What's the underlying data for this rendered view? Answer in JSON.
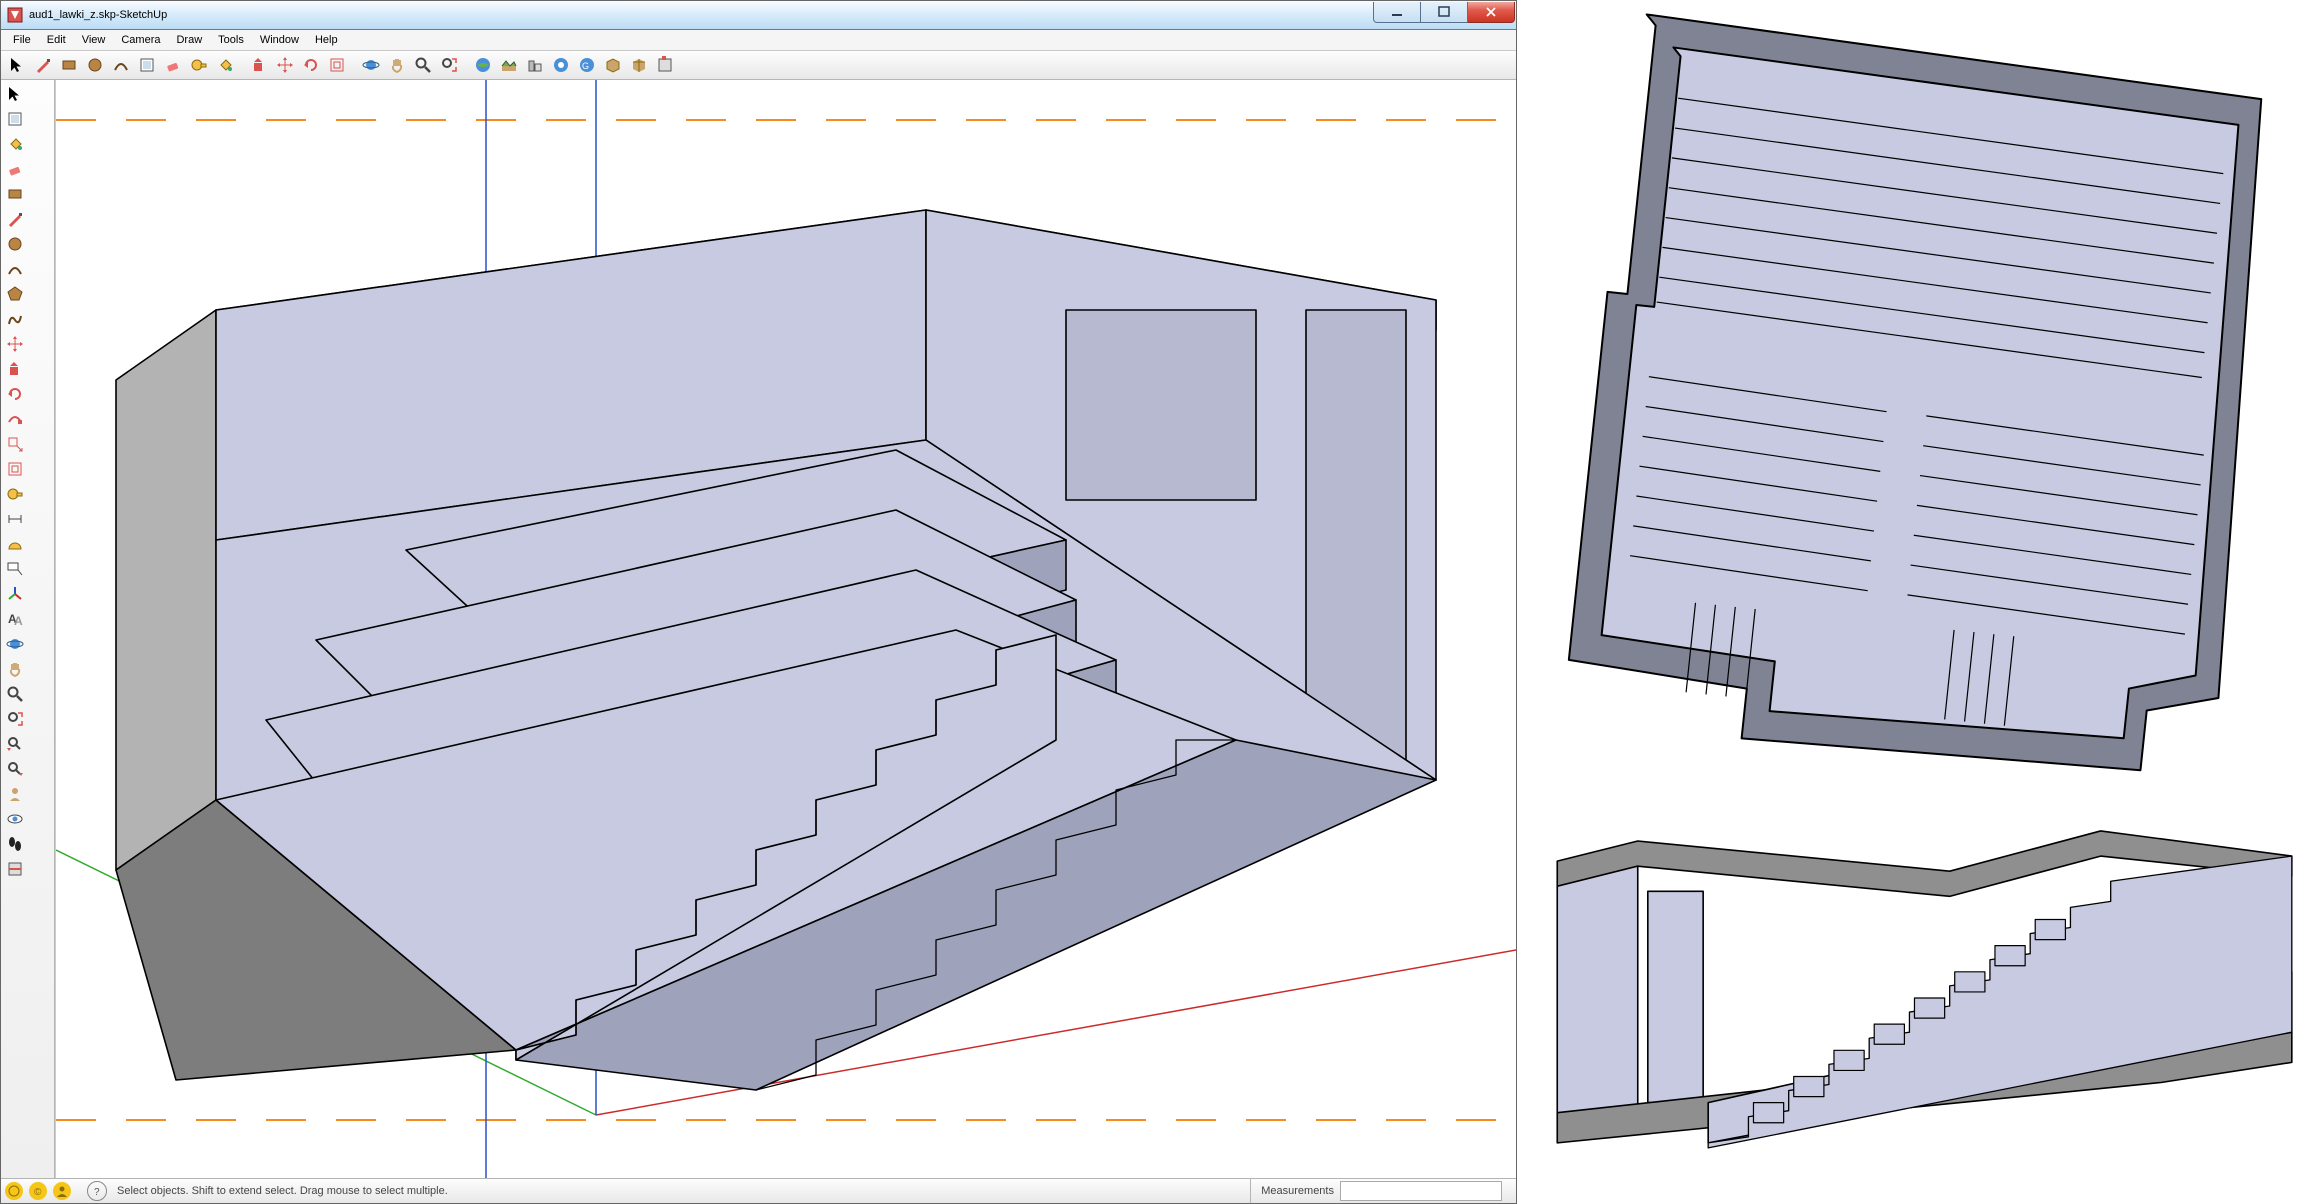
{
  "window": {
    "filename": "aud1_lawki_z.skp",
    "appname": "SketchUp",
    "sep": " - "
  },
  "menu": [
    "File",
    "Edit",
    "View",
    "Camera",
    "Draw",
    "Tools",
    "Window",
    "Help"
  ],
  "main_toolbar_icons": [
    "select-arrow-icon",
    "line-pencil-icon",
    "rectangle-icon",
    "circle-icon",
    "arc-icon",
    "make-component-icon",
    "eraser-icon",
    "tape-measure-icon",
    "paint-bucket-icon",
    "sep",
    "push-pull-icon",
    "move-icon",
    "rotate-icon",
    "offset-icon",
    "sep",
    "orbit-icon",
    "pan-icon",
    "zoom-icon",
    "zoom-extents-icon",
    "sep",
    "add-location-icon",
    "toggle-terrain-icon",
    "add-building-icon",
    "photo-textures-icon",
    "preview-ge-icon",
    "get-models-icon",
    "share-model-icon",
    "extensions-icon"
  ],
  "left_toolbox_icons": [
    "select-arrow-icon",
    "make-component-icon",
    "paint-bucket-icon",
    "eraser-icon",
    "rectangle-icon",
    "line-pencil-icon",
    "circle-icon",
    "arc-icon",
    "polygon-icon",
    "freehand-icon",
    "move-icon",
    "push-pull-icon",
    "rotate-icon",
    "follow-me-icon",
    "scale-icon",
    "offset-icon",
    "tape-measure-icon",
    "dimension-icon",
    "protractor-icon",
    "text-label-icon",
    "axes-icon",
    "3d-text-icon",
    "orbit-icon",
    "pan-icon",
    "zoom-icon",
    "zoom-extents-icon",
    "prev-view-icon",
    "next-view-icon",
    "position-camera-icon",
    "look-around-icon",
    "walk-icon",
    "section-plane-icon"
  ],
  "win_buttons": {
    "min": "minimize-icon",
    "max": "maximize-restore-icon",
    "close": "close-icon"
  },
  "status": {
    "geo_icon": "geo-location-icon",
    "credit_icon": "credit-icon",
    "user_icon": "user-signin-icon",
    "help_icon": "help-icon",
    "hint": "Select objects. Shift to extend select. Drag mouse to select multiple.",
    "measure_label": "Measurements",
    "measure_value": ""
  },
  "colors": {
    "model_fill": "#c7cae0",
    "model_shadow": "#7f8393",
    "model_dark": "#a1a1a1",
    "axis_red": "#cc2b2b",
    "axis_green": "#2faa2f",
    "axis_blue": "#2b4fcc",
    "horizon": "#f58b1f"
  }
}
